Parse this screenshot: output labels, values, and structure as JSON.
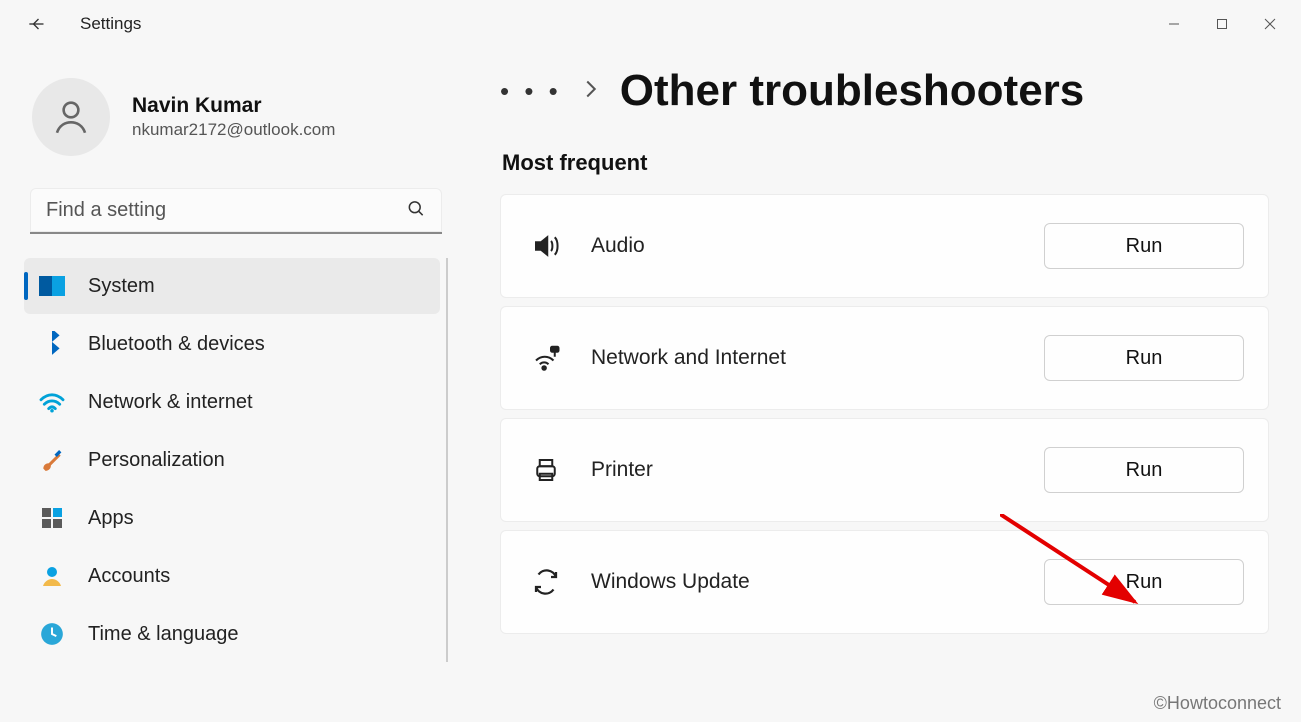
{
  "header": {
    "app_title": "Settings"
  },
  "profile": {
    "name": "Navin Kumar",
    "email": "nkumar2172@outlook.com"
  },
  "search": {
    "placeholder": "Find a setting"
  },
  "sidebar": {
    "items": [
      {
        "key": "system",
        "label": "System",
        "active": true
      },
      {
        "key": "bluetooth-devices",
        "label": "Bluetooth & devices",
        "active": false
      },
      {
        "key": "network-internet",
        "label": "Network & internet",
        "active": false
      },
      {
        "key": "personalization",
        "label": "Personalization",
        "active": false
      },
      {
        "key": "apps",
        "label": "Apps",
        "active": false
      },
      {
        "key": "accounts",
        "label": "Accounts",
        "active": false
      },
      {
        "key": "time-language",
        "label": "Time & language",
        "active": false
      }
    ]
  },
  "breadcrumb": {
    "ellipsis": "…",
    "title": "Other troubleshooters"
  },
  "section": {
    "most_frequent": "Most frequent"
  },
  "troubleshooters": [
    {
      "key": "audio",
      "label": "Audio",
      "button": "Run"
    },
    {
      "key": "network-internet",
      "label": "Network and Internet",
      "button": "Run"
    },
    {
      "key": "printer",
      "label": "Printer",
      "button": "Run"
    },
    {
      "key": "windows-update",
      "label": "Windows Update",
      "button": "Run"
    }
  ],
  "watermark": "©Howtoconnect"
}
